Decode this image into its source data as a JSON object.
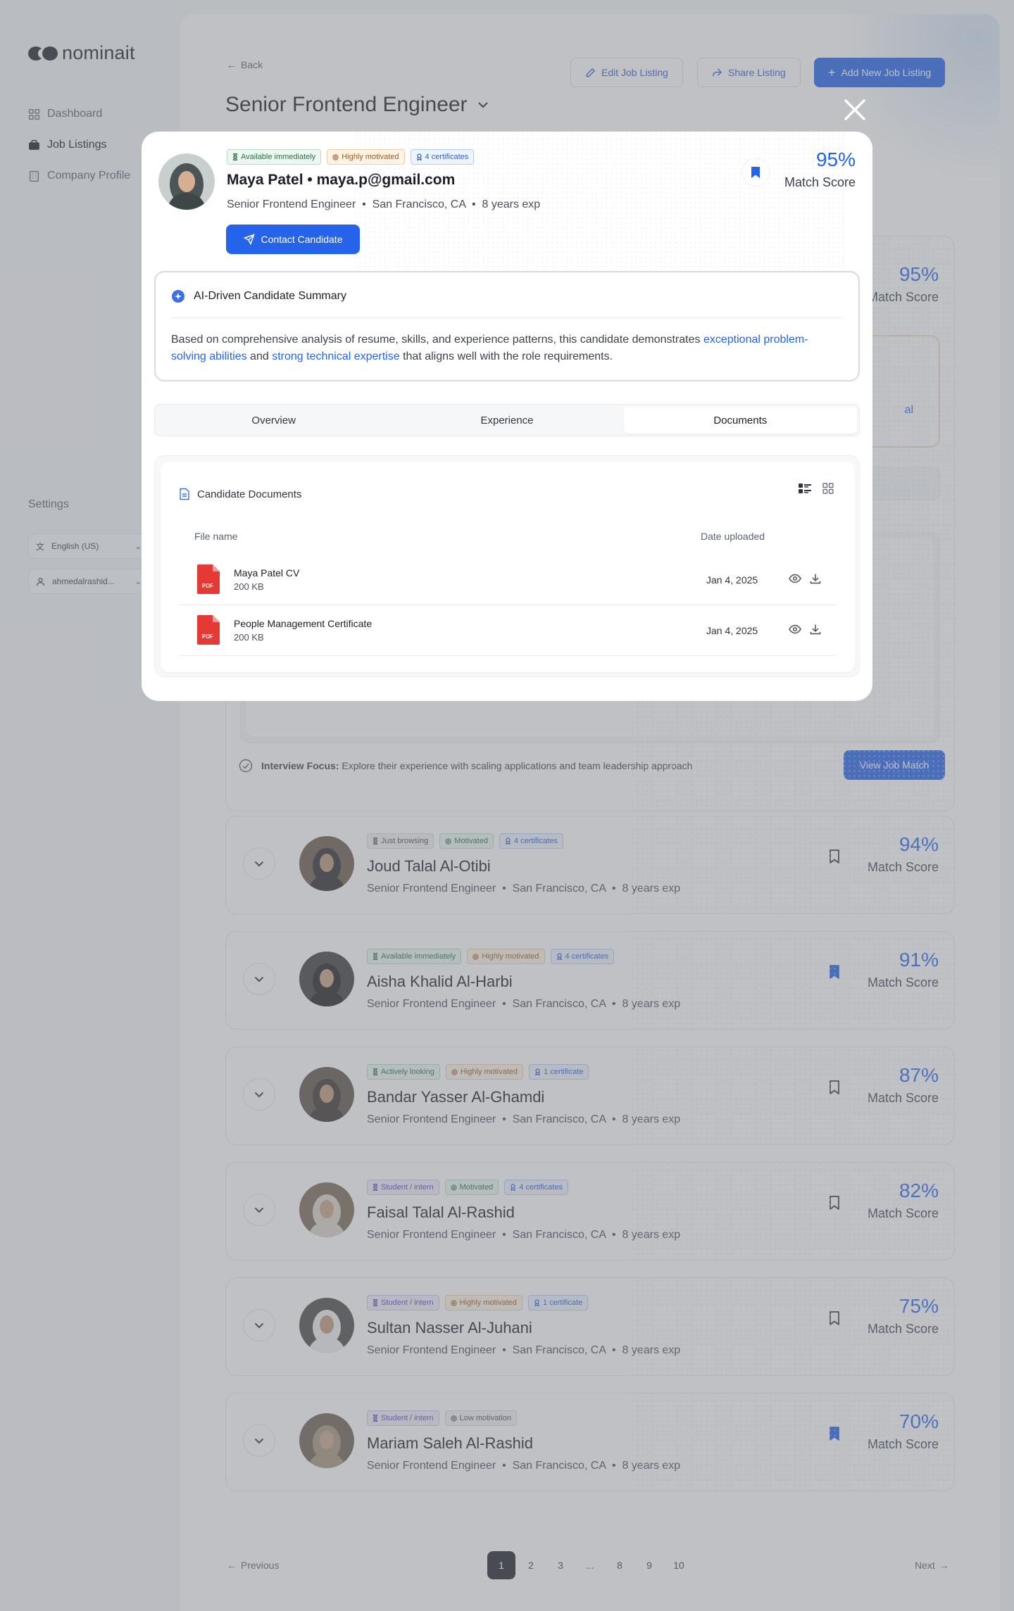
{
  "app": {
    "name": "nominait"
  },
  "sidebar": {
    "items": [
      {
        "label": "Dashboard",
        "icon": "dashboard-icon"
      },
      {
        "label": "Job Listings",
        "icon": "briefcase-icon"
      },
      {
        "label": "Company Profile",
        "icon": "building-icon"
      }
    ],
    "settings_label": "Settings",
    "language": "English (US)",
    "user": "ahmedalrashid..."
  },
  "header": {
    "back": "Back",
    "title": "Senior Frontend Engineer",
    "edit_btn": "Edit Job Listing",
    "share_btn": "Share Listing",
    "add_btn": "Add New Job Listing"
  },
  "background_card": {
    "score": "95%",
    "score_label": "Match Score",
    "partial_link": "al",
    "focus_label": "Interview Focus:",
    "focus_text": " Explore their experience with scaling applications and team leadership approach",
    "view_btn": "View Job Match"
  },
  "candidates": [
    {
      "name": "Joud Talal Al-Otibi",
      "meta": "Senior Frontend Engineer  •  San Francisco, CA  •  8 years exp",
      "score": "94%",
      "bookmarked": false,
      "badges": [
        {
          "text": "Just browsing",
          "kind": "browse"
        },
        {
          "text": "Motivated",
          "kind": "motiv"
        },
        {
          "text": "4 certificates",
          "kind": "cert"
        }
      ]
    },
    {
      "name": "Aisha Khalid Al-Harbi",
      "meta": "Senior Frontend Engineer  •  San Francisco, CA  •  8 years exp",
      "score": "91%",
      "bookmarked": true,
      "badges": [
        {
          "text": "Available immediately",
          "kind": "avail"
        },
        {
          "text": "Highly motivated",
          "kind": "high"
        },
        {
          "text": "4 certificates",
          "kind": "cert"
        }
      ]
    },
    {
      "name": "Bandar Yasser Al-Ghamdi",
      "meta": "Senior Frontend Engineer  •  San Francisco, CA  •  8 years exp",
      "score": "87%",
      "bookmarked": false,
      "badges": [
        {
          "text": "Actively looking",
          "kind": "active"
        },
        {
          "text": "Highly motivated",
          "kind": "high"
        },
        {
          "text": "1 certificate",
          "kind": "cert"
        }
      ]
    },
    {
      "name": "Faisal Talal Al-Rashid",
      "meta": "Senior Frontend Engineer  •  San Francisco, CA  •  8 years exp",
      "score": "82%",
      "bookmarked": false,
      "badges": [
        {
          "text": "Student / intern",
          "kind": "student"
        },
        {
          "text": "Motivated",
          "kind": "motiv"
        },
        {
          "text": "4 certificates",
          "kind": "cert"
        }
      ]
    },
    {
      "name": "Sultan Nasser Al-Juhani",
      "meta": "Senior Frontend Engineer  •  San Francisco, CA  •  8 years exp",
      "score": "75%",
      "bookmarked": false,
      "badges": [
        {
          "text": "Student / intern",
          "kind": "student"
        },
        {
          "text": "Highly motivated",
          "kind": "high"
        },
        {
          "text": "1 certificate",
          "kind": "cert"
        }
      ]
    },
    {
      "name": "Mariam Saleh Al-Rashid",
      "meta": "Senior Frontend Engineer  •  San Francisco, CA  •  8 years exp",
      "score": "70%",
      "bookmarked": true,
      "badges": [
        {
          "text": "Student / intern",
          "kind": "student"
        },
        {
          "text": "Low motivation",
          "kind": "low"
        }
      ]
    }
  ],
  "pagination": {
    "prev": "Previous",
    "next": "Next",
    "pages": [
      "1",
      "2",
      "3",
      "...",
      "8",
      "9",
      "10"
    ],
    "current": "1"
  },
  "modal": {
    "badges": [
      {
        "text": "Available immediately",
        "kind": "avail"
      },
      {
        "text": "Highly motivated",
        "kind": "high"
      },
      {
        "text": "4 certificates",
        "kind": "cert"
      }
    ],
    "name_email": "Maya Patel • maya.p@gmail.com",
    "meta": "Senior Frontend Engineer  •  San Francisco, CA  •  8 years exp",
    "contact_btn": "Contact Candidate",
    "score": "95%",
    "score_label": "Match Score",
    "ai_title": "AI-Driven Candidate Summary",
    "ai_text_1": "Based on comprehensive analysis of resume, skills, and experience patterns, this candidate demonstrates ",
    "ai_hl_1": "exceptional problem-solving abilities",
    "ai_text_2": " and ",
    "ai_hl_2": "strong technical expertise",
    "ai_text_3": " that aligns well with the role requirements.",
    "tabs": [
      "Overview",
      "Experience",
      "Documents"
    ],
    "active_tab": "Documents",
    "docs_title": "Candidate Documents",
    "col_file": "File name",
    "col_date": "Date uploaded",
    "pdf_label": "PDF",
    "documents": [
      {
        "name": "Maya Patel CV",
        "size": "200 KB",
        "date": "Jan 4, 2025"
      },
      {
        "name": "People Management Certificate",
        "size": "200 KB",
        "date": "Jan 4, 2025"
      }
    ]
  },
  "colors": {
    "accent": "#2563eb",
    "dark": "#1b1e26",
    "overlay": "#787c84"
  }
}
